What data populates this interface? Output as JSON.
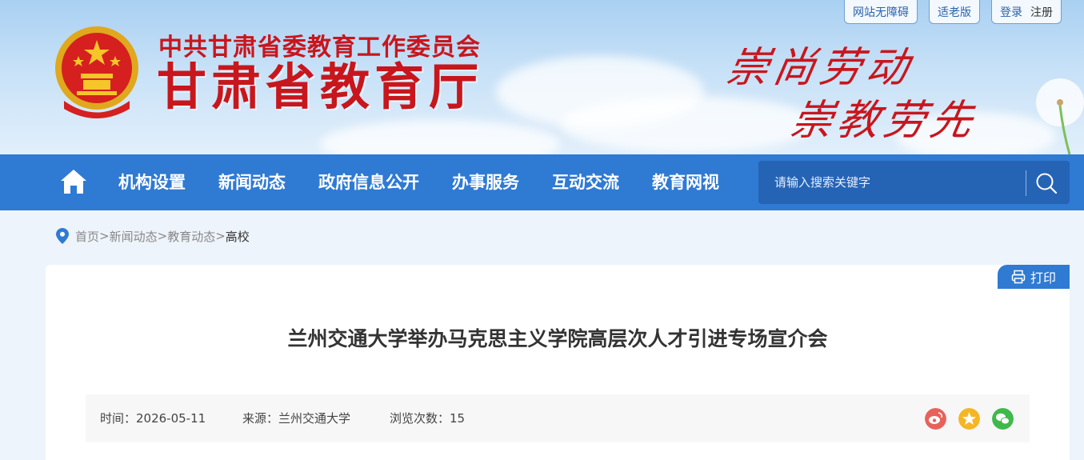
{
  "header": {
    "top_links": {
      "accessible": "网站无障碍",
      "elderly": "适老版",
      "login": "登录",
      "register": "注册"
    },
    "subtitle": "中共甘肃省委教育工作委员会",
    "title": "甘肃省教育厅",
    "slogan_line1": "崇尚劳动",
    "slogan_line2": "崇教劳先"
  },
  "nav": {
    "items": [
      "机构设置",
      "新闻动态",
      "政府信息公开",
      "办事服务",
      "互动交流",
      "教育网视"
    ],
    "search_placeholder": "请输入搜索关键字"
  },
  "breadcrumb": {
    "home": "首页",
    "sep": ">",
    "level1": "新闻动态",
    "level2": "教育动态",
    "current": "高校"
  },
  "article": {
    "print_label": "打印",
    "title": "兰州交通大学举办马克思主义学院高层次人才引进专场宣介会",
    "time_label": "时间：2026-05-11",
    "source_label": "来源：兰州交通大学",
    "views_label": "浏览次数：15"
  },
  "colors": {
    "nav_bg": "#2f7ad3",
    "brand_red": "#c8161d",
    "weibo": "#e8625b",
    "qzone": "#f4b625",
    "wechat": "#3fb94b"
  }
}
